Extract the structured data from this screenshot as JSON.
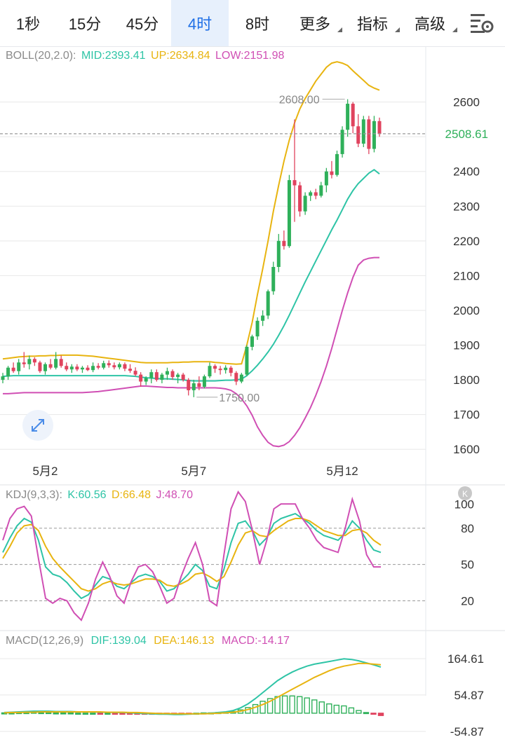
{
  "tabs": [
    {
      "label": "1秒",
      "active": false,
      "dropdown": false
    },
    {
      "label": "15分",
      "active": false,
      "dropdown": false
    },
    {
      "label": "45分",
      "active": false,
      "dropdown": false
    },
    {
      "label": "4时",
      "active": true,
      "dropdown": false
    },
    {
      "label": "8时",
      "active": false,
      "dropdown": false
    },
    {
      "label": "更多",
      "active": false,
      "dropdown": true
    },
    {
      "label": "指标",
      "active": false,
      "dropdown": true
    },
    {
      "label": "高级",
      "active": false,
      "dropdown": true
    }
  ],
  "settings_icon": "chart-settings-icon",
  "colors": {
    "up": "#2fb05a",
    "down": "#e0435e",
    "mid": "#2ec4a6",
    "upper": "#e8b410",
    "lower": "#d04fb4",
    "k": "#2ec4a6",
    "d": "#e8b410",
    "j": "#d04fb4",
    "grid": "#e8e8e8",
    "price_tag": "#2fb05a"
  },
  "boll": {
    "name": "BOLL(20,2.0):",
    "mid_label": "MID:2393.41",
    "up_label": "UP:2634.84",
    "low_label": "LOW:2151.98"
  },
  "kdj": {
    "name": "KDJ(9,3,3):",
    "k_label": "K:60.56",
    "d_label": "D:66.48",
    "j_label": "J:48.70"
  },
  "macd": {
    "name": "MACD(12,26,9)",
    "dif_label": "DIF:139.04",
    "dea_label": "DEA:146.13",
    "macd_label": "MACD:-14.17"
  },
  "price_axis_labels": [
    "2600",
    "2500",
    "2400",
    "2300",
    "2200",
    "2100",
    "2000",
    "1900",
    "1800",
    "1700",
    "1600"
  ],
  "current_price": "2508.61",
  "high_marker": "2608.00",
  "low_marker": "1750.00",
  "kdj_axis_labels": [
    "100",
    "80",
    "50",
    "20"
  ],
  "macd_axis_labels": [
    "164.61",
    "54.87",
    "-54.87"
  ],
  "date_labels": [
    "5月2",
    "5月7",
    "5月12"
  ],
  "chart_data": [
    {
      "type": "candlestick",
      "title": "BOLL(20,2.0)",
      "x_dates": [
        "5月2",
        "5月7",
        "5月12"
      ],
      "ylim": [
        1550,
        2700
      ],
      "candles": [
        {
          "o": 1800,
          "h": 1820,
          "l": 1790,
          "c": 1810
        },
        {
          "o": 1810,
          "h": 1840,
          "l": 1800,
          "c": 1835
        },
        {
          "o": 1835,
          "h": 1850,
          "l": 1820,
          "c": 1825
        },
        {
          "o": 1825,
          "h": 1860,
          "l": 1815,
          "c": 1850
        },
        {
          "o": 1850,
          "h": 1880,
          "l": 1835,
          "c": 1845
        },
        {
          "o": 1845,
          "h": 1870,
          "l": 1830,
          "c": 1860
        },
        {
          "o": 1860,
          "h": 1865,
          "l": 1840,
          "c": 1850
        },
        {
          "o": 1850,
          "h": 1855,
          "l": 1820,
          "c": 1825
        },
        {
          "o": 1825,
          "h": 1850,
          "l": 1815,
          "c": 1845
        },
        {
          "o": 1845,
          "h": 1860,
          "l": 1830,
          "c": 1835
        },
        {
          "o": 1835,
          "h": 1880,
          "l": 1830,
          "c": 1860
        },
        {
          "o": 1860,
          "h": 1870,
          "l": 1835,
          "c": 1840
        },
        {
          "o": 1840,
          "h": 1850,
          "l": 1825,
          "c": 1830
        },
        {
          "o": 1830,
          "h": 1845,
          "l": 1820,
          "c": 1838
        },
        {
          "o": 1838,
          "h": 1845,
          "l": 1825,
          "c": 1830
        },
        {
          "o": 1830,
          "h": 1840,
          "l": 1820,
          "c": 1835
        },
        {
          "o": 1835,
          "h": 1842,
          "l": 1825,
          "c": 1828
        },
        {
          "o": 1828,
          "h": 1850,
          "l": 1822,
          "c": 1840
        },
        {
          "o": 1840,
          "h": 1848,
          "l": 1830,
          "c": 1835
        },
        {
          "o": 1835,
          "h": 1855,
          "l": 1830,
          "c": 1848
        },
        {
          "o": 1848,
          "h": 1856,
          "l": 1835,
          "c": 1842
        },
        {
          "o": 1842,
          "h": 1850,
          "l": 1830,
          "c": 1836
        },
        {
          "o": 1836,
          "h": 1850,
          "l": 1830,
          "c": 1845
        },
        {
          "o": 1845,
          "h": 1850,
          "l": 1825,
          "c": 1832
        },
        {
          "o": 1832,
          "h": 1845,
          "l": 1820,
          "c": 1826
        },
        {
          "o": 1826,
          "h": 1836,
          "l": 1810,
          "c": 1815
        },
        {
          "o": 1815,
          "h": 1822,
          "l": 1780,
          "c": 1795
        },
        {
          "o": 1795,
          "h": 1810,
          "l": 1785,
          "c": 1805
        },
        {
          "o": 1805,
          "h": 1830,
          "l": 1790,
          "c": 1822
        },
        {
          "o": 1822,
          "h": 1830,
          "l": 1795,
          "c": 1800
        },
        {
          "o": 1800,
          "h": 1820,
          "l": 1790,
          "c": 1815
        },
        {
          "o": 1815,
          "h": 1835,
          "l": 1800,
          "c": 1825
        },
        {
          "o": 1825,
          "h": 1830,
          "l": 1800,
          "c": 1808
        },
        {
          "o": 1808,
          "h": 1820,
          "l": 1790,
          "c": 1815
        },
        {
          "o": 1815,
          "h": 1820,
          "l": 1795,
          "c": 1800
        },
        {
          "o": 1800,
          "h": 1805,
          "l": 1755,
          "c": 1770
        },
        {
          "o": 1770,
          "h": 1800,
          "l": 1750,
          "c": 1790
        },
        {
          "o": 1790,
          "h": 1810,
          "l": 1770,
          "c": 1780
        },
        {
          "o": 1780,
          "h": 1815,
          "l": 1775,
          "c": 1810
        },
        {
          "o": 1810,
          "h": 1850,
          "l": 1805,
          "c": 1840
        },
        {
          "o": 1840,
          "h": 1845,
          "l": 1820,
          "c": 1832
        },
        {
          "o": 1832,
          "h": 1840,
          "l": 1815,
          "c": 1828
        },
        {
          "o": 1828,
          "h": 1842,
          "l": 1818,
          "c": 1835
        },
        {
          "o": 1835,
          "h": 1840,
          "l": 1810,
          "c": 1820
        },
        {
          "o": 1820,
          "h": 1825,
          "l": 1785,
          "c": 1795
        },
        {
          "o": 1795,
          "h": 1820,
          "l": 1790,
          "c": 1815
        },
        {
          "o": 1815,
          "h": 1900,
          "l": 1810,
          "c": 1895
        },
        {
          "o": 1895,
          "h": 1930,
          "l": 1885,
          "c": 1925
        },
        {
          "o": 1925,
          "h": 1980,
          "l": 1915,
          "c": 1970
        },
        {
          "o": 1970,
          "h": 2000,
          "l": 1955,
          "c": 1985
        },
        {
          "o": 1985,
          "h": 2060,
          "l": 1975,
          "c": 2055
        },
        {
          "o": 2055,
          "h": 2140,
          "l": 2045,
          "c": 2125
        },
        {
          "o": 2125,
          "h": 2220,
          "l": 2110,
          "c": 2200
        },
        {
          "o": 2200,
          "h": 2230,
          "l": 2175,
          "c": 2185
        },
        {
          "o": 2185,
          "h": 2390,
          "l": 2180,
          "c": 2375
        },
        {
          "o": 2375,
          "h": 2550,
          "l": 2255,
          "c": 2360
        },
        {
          "o": 2360,
          "h": 2370,
          "l": 2270,
          "c": 2285
        },
        {
          "o": 2285,
          "h": 2340,
          "l": 2275,
          "c": 2330
        },
        {
          "o": 2330,
          "h": 2345,
          "l": 2315,
          "c": 2340
        },
        {
          "o": 2340,
          "h": 2350,
          "l": 2320,
          "c": 2330
        },
        {
          "o": 2330,
          "h": 2370,
          "l": 2325,
          "c": 2360
        },
        {
          "o": 2360,
          "h": 2410,
          "l": 2340,
          "c": 2400
        },
        {
          "o": 2400,
          "h": 2430,
          "l": 2380,
          "c": 2390
        },
        {
          "o": 2390,
          "h": 2460,
          "l": 2385,
          "c": 2450
        },
        {
          "o": 2450,
          "h": 2530,
          "l": 2440,
          "c": 2520
        },
        {
          "o": 2520,
          "h": 2608,
          "l": 2500,
          "c": 2595
        },
        {
          "o": 2595,
          "h": 2600,
          "l": 2510,
          "c": 2530
        },
        {
          "o": 2530,
          "h": 2565,
          "l": 2470,
          "c": 2480
        },
        {
          "o": 2480,
          "h": 2560,
          "l": 2470,
          "c": 2550
        },
        {
          "o": 2550,
          "h": 2560,
          "l": 2450,
          "c": 2465
        },
        {
          "o": 2465,
          "h": 2560,
          "l": 2455,
          "c": 2545
        },
        {
          "o": 2545,
          "h": 2555,
          "l": 2500,
          "c": 2508
        }
      ],
      "series": [
        {
          "name": "MID",
          "values": [
            1810,
            1811,
            1812,
            1812,
            1812,
            1812,
            1812,
            1812,
            1812,
            1812,
            1812,
            1812,
            1812,
            1812,
            1812,
            1812,
            1812,
            1812,
            1812,
            1812,
            1812,
            1812,
            1812,
            1812,
            1811,
            1810,
            1808,
            1806,
            1805,
            1804,
            1803,
            1803,
            1802,
            1801,
            1800,
            1798,
            1797,
            1797,
            1797,
            1797,
            1797,
            1798,
            1799,
            1799,
            1800,
            1802,
            1812,
            1826,
            1842,
            1860,
            1880,
            1902,
            1928,
            1956,
            1986,
            2018,
            2050,
            2082,
            2112,
            2142,
            2172,
            2202,
            2232,
            2260,
            2290,
            2320,
            2345,
            2365,
            2380,
            2395,
            2405,
            2393
          ]
        },
        {
          "name": "UP",
          "values": [
            1860,
            1862,
            1864,
            1866,
            1867,
            1868,
            1868,
            1869,
            1869,
            1870,
            1870,
            1871,
            1871,
            1871,
            1871,
            1870,
            1869,
            1868,
            1866,
            1864,
            1862,
            1860,
            1858,
            1856,
            1854,
            1852,
            1850,
            1849,
            1849,
            1849,
            1849,
            1849,
            1850,
            1850,
            1851,
            1851,
            1852,
            1852,
            1852,
            1852,
            1850,
            1849,
            1847,
            1846,
            1845,
            1846,
            1900,
            1965,
            2045,
            2120,
            2200,
            2285,
            2360,
            2430,
            2490,
            2540,
            2580,
            2610,
            2635,
            2660,
            2680,
            2700,
            2712,
            2716,
            2712,
            2705,
            2690,
            2676,
            2662,
            2648,
            2640,
            2634
          ]
        },
        {
          "name": "LOW",
          "values": [
            1760,
            1760,
            1761,
            1762,
            1763,
            1763,
            1763,
            1763,
            1763,
            1763,
            1763,
            1763,
            1763,
            1763,
            1763,
            1763,
            1764,
            1765,
            1766,
            1768,
            1770,
            1772,
            1774,
            1776,
            1778,
            1780,
            1782,
            1782,
            1781,
            1780,
            1779,
            1778,
            1778,
            1777,
            1777,
            1777,
            1777,
            1777,
            1777,
            1777,
            1777,
            1776,
            1774,
            1770,
            1760,
            1745,
            1725,
            1698,
            1665,
            1640,
            1620,
            1610,
            1608,
            1612,
            1622,
            1640,
            1662,
            1690,
            1720,
            1755,
            1795,
            1840,
            1890,
            1945,
            2000,
            2050,
            2095,
            2130,
            2145,
            2150,
            2152,
            2152
          ]
        }
      ]
    },
    {
      "type": "line",
      "title": "KDJ(9,3,3)",
      "ylim": [
        0,
        110
      ],
      "series": [
        {
          "name": "K",
          "values": [
            60,
            72,
            82,
            88,
            85,
            70,
            48,
            42,
            40,
            35,
            28,
            22,
            25,
            33,
            40,
            38,
            32,
            30,
            35,
            40,
            42,
            40,
            36,
            28,
            30,
            36,
            42,
            50,
            45,
            32,
            30,
            46,
            68,
            84,
            86,
            78,
            66,
            72,
            84,
            88,
            90,
            92,
            88,
            84,
            78,
            74,
            72,
            70,
            76,
            86,
            80,
            70,
            62,
            60
          ]
        },
        {
          "name": "D",
          "values": [
            55,
            65,
            76,
            82,
            83,
            78,
            65,
            55,
            48,
            42,
            36,
            30,
            28,
            30,
            34,
            36,
            34,
            33,
            34,
            36,
            38,
            38,
            37,
            33,
            32,
            34,
            37,
            42,
            43,
            40,
            36,
            40,
            52,
            66,
            76,
            78,
            74,
            73,
            78,
            82,
            86,
            88,
            88,
            86,
            82,
            78,
            76,
            74,
            74,
            78,
            79,
            76,
            70,
            66
          ]
        },
        {
          "name": "J",
          "values": [
            70,
            88,
            96,
            98,
            90,
            55,
            22,
            18,
            22,
            20,
            10,
            4,
            18,
            38,
            52,
            40,
            24,
            18,
            36,
            48,
            50,
            44,
            32,
            18,
            22,
            40,
            55,
            68,
            50,
            20,
            16,
            58,
            96,
            110,
            102,
            78,
            50,
            70,
            96,
            100,
            100,
            100,
            88,
            80,
            70,
            64,
            62,
            60,
            80,
            104,
            86,
            58,
            48,
            48
          ]
        }
      ]
    },
    {
      "type": "bar",
      "title": "MACD(12,26,9)",
      "ylim": [
        -70,
        190
      ],
      "series": [
        {
          "name": "DIF",
          "values": [
            2,
            3,
            4,
            5,
            6,
            6,
            6,
            5,
            5,
            5,
            4,
            4,
            4,
            3,
            3,
            2,
            2,
            1,
            0,
            -1,
            -2,
            -3,
            -3,
            -4,
            -4,
            -3,
            -2,
            -1,
            0,
            2,
            4,
            8,
            16,
            28,
            44,
            62,
            80,
            98,
            112,
            124,
            134,
            142,
            148,
            152,
            156,
            160,
            164,
            162,
            158,
            152,
            146,
            139
          ]
        },
        {
          "name": "DEA",
          "values": [
            1,
            2,
            2,
            3,
            3,
            4,
            4,
            4,
            4,
            4,
            4,
            4,
            4,
            4,
            3,
            3,
            3,
            2,
            2,
            1,
            0,
            -1,
            -1,
            -2,
            -2,
            -2,
            -2,
            -2,
            -1,
            0,
            1,
            3,
            6,
            11,
            18,
            26,
            36,
            48,
            60,
            72,
            84,
            96,
            108,
            118,
            128,
            136,
            142,
            146,
            150,
            150,
            148,
            146
          ]
        },
        {
          "name": "MACD",
          "values": [
            1,
            1,
            2,
            2,
            3,
            2,
            2,
            1,
            1,
            1,
            0,
            0,
            0,
            -1,
            0,
            -1,
            -1,
            -1,
            -2,
            -2,
            -2,
            -2,
            -2,
            -2,
            -2,
            -1,
            0,
            1,
            1,
            2,
            3,
            5,
            10,
            17,
            26,
            36,
            44,
            50,
            52,
            52,
            50,
            46,
            40,
            34,
            28,
            24,
            22,
            16,
            8,
            2,
            -2,
            -7
          ]
        }
      ]
    }
  ]
}
